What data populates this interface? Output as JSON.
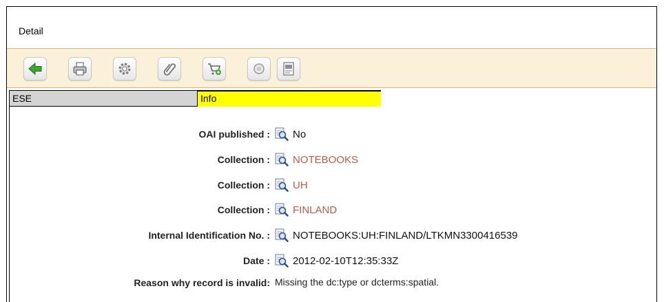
{
  "header": {
    "title": "Detail"
  },
  "toolbar": {
    "buttons": [
      {
        "name": "back",
        "icon": "green-arrow-left-icon"
      },
      {
        "name": "print",
        "icon": "printer-icon"
      },
      {
        "name": "settings",
        "icon": "gear-icon"
      },
      {
        "name": "attach",
        "icon": "paperclip-icon"
      },
      {
        "name": "add-to-cart",
        "icon": "cart-add-icon"
      },
      {
        "name": "record",
        "icon": "circle-icon"
      },
      {
        "name": "export",
        "icon": "document-icon"
      }
    ]
  },
  "tabs": {
    "ese": "ESE",
    "info": "Info"
  },
  "fields": {
    "oai_published": {
      "label": "OAI published :",
      "value": "No"
    },
    "collection1": {
      "label": "Collection :",
      "value": "NOTEBOOKS"
    },
    "collection2": {
      "label": "Collection :",
      "value": "UH"
    },
    "collection3": {
      "label": "Collection :",
      "value": "FINLAND"
    },
    "internal_id": {
      "label": "Internal Identification No. :",
      "value": "NOTEBOOKS:UH:FINLAND/LTKMN3300416539"
    },
    "date": {
      "label": "Date :",
      "value": "2012-02-10T12:35:33Z"
    },
    "invalid_reason": {
      "label": "Reason why record is invalid:",
      "value": "Missing the dc:type or dcterms:spatial."
    }
  },
  "colors": {
    "link": "#b95c46",
    "info_tab": "#ffff00",
    "toolbar_bg": "#fbf1d8"
  }
}
